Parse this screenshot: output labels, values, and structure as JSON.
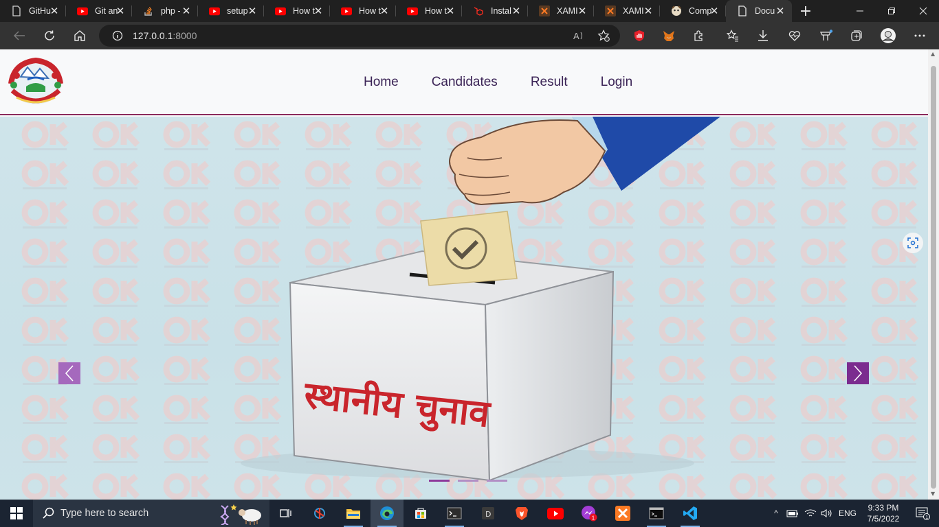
{
  "browser": {
    "tabs": [
      {
        "label": "GitHu",
        "icon": "page-icon"
      },
      {
        "label": "Git an",
        "icon": "youtube-icon"
      },
      {
        "label": "php -",
        "icon": "stackoverflow-icon"
      },
      {
        "label": "setup",
        "icon": "youtube-icon"
      },
      {
        "label": "How t",
        "icon": "youtube-icon"
      },
      {
        "label": "How t",
        "icon": "youtube-icon"
      },
      {
        "label": "How t",
        "icon": "youtube-icon"
      },
      {
        "label": "Instal",
        "icon": "laravel-icon"
      },
      {
        "label": "XAMI",
        "icon": "xampp-icon"
      },
      {
        "label": "XAMI",
        "icon": "xampp-icon"
      },
      {
        "label": "Comp",
        "icon": "composer-icon"
      },
      {
        "label": "Docu",
        "icon": "page-icon",
        "active": true
      }
    ],
    "address": {
      "host": "127.0.0.1",
      "port": ":8000"
    }
  },
  "site": {
    "nav": [
      "Home",
      "Candidates",
      "Result",
      "Login"
    ],
    "hero": {
      "image_text": "स्थानीय चुनाव",
      "slides": 3,
      "active_slide": 1
    }
  },
  "taskbar": {
    "search_placeholder": "Type here to search",
    "language": "ENG",
    "time": "9:33 PM",
    "date": "7/5/2022",
    "notification_count": "1",
    "badge_count": "1"
  },
  "colors": {
    "accent": "#8b2a5b",
    "nav_text": "#3b2456",
    "carousel_prev": "#a569bd",
    "carousel_next": "#7b2c8f"
  }
}
